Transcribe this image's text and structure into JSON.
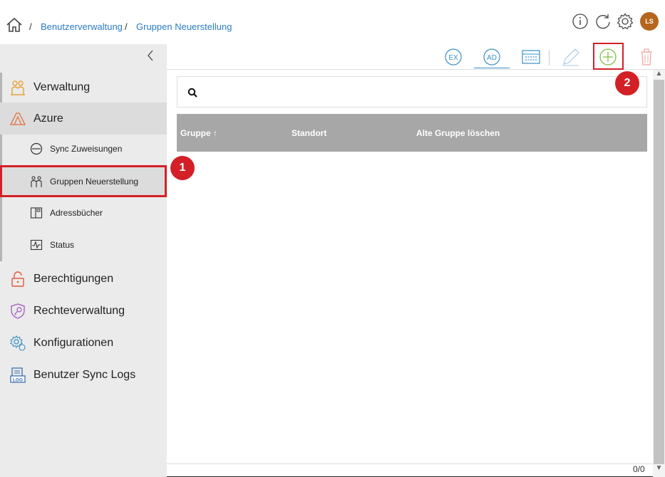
{
  "breadcrumb": {
    "separator": "/",
    "items": [
      "Benutzerverwaltung",
      "Gruppen Neuerstellung"
    ]
  },
  "header": {
    "icons": [
      "info-icon",
      "refresh-icon",
      "settings-icon"
    ],
    "avatar_initials": "LS",
    "avatar_color": "#b5651d"
  },
  "sidebar": {
    "items": [
      {
        "label": "Verwaltung",
        "icon": "people-icon"
      },
      {
        "label": "Azure",
        "icon": "azure-icon"
      },
      {
        "label": "Berechtigungen",
        "icon": "lock-icon"
      },
      {
        "label": "Rechteverwaltung",
        "icon": "shield-key-icon"
      },
      {
        "label": "Konfigurationen",
        "icon": "config-gear-icon"
      },
      {
        "label": "Benutzer Sync Logs",
        "icon": "log-icon"
      }
    ],
    "subitems": [
      {
        "label": "Sync Zuweisungen",
        "icon": "sync-icon"
      },
      {
        "label": "Gruppen Neuerstellung",
        "icon": "groups-icon"
      },
      {
        "label": "Adressbücher",
        "icon": "addressbook-icon"
      },
      {
        "label": "Status",
        "icon": "status-icon"
      }
    ]
  },
  "toolbar": {
    "export_label": "EX",
    "ad_label": "AD",
    "buttons": [
      "export-button",
      "ad-import-button",
      "keyboard-button",
      "edit-button",
      "add-button",
      "delete-button"
    ]
  },
  "search": {
    "placeholder": "",
    "value": ""
  },
  "table": {
    "columns": [
      "Gruppe ↑",
      "Standort",
      "Alte Gruppe löschen"
    ],
    "rows": []
  },
  "pager": {
    "text": "0/0"
  },
  "callouts": [
    "1",
    "2"
  ],
  "colors": {
    "accent_red": "#d32027",
    "link_blue": "#2a7cc6",
    "header_gray": "#a7a7a7",
    "add_green": "#7cc142"
  }
}
